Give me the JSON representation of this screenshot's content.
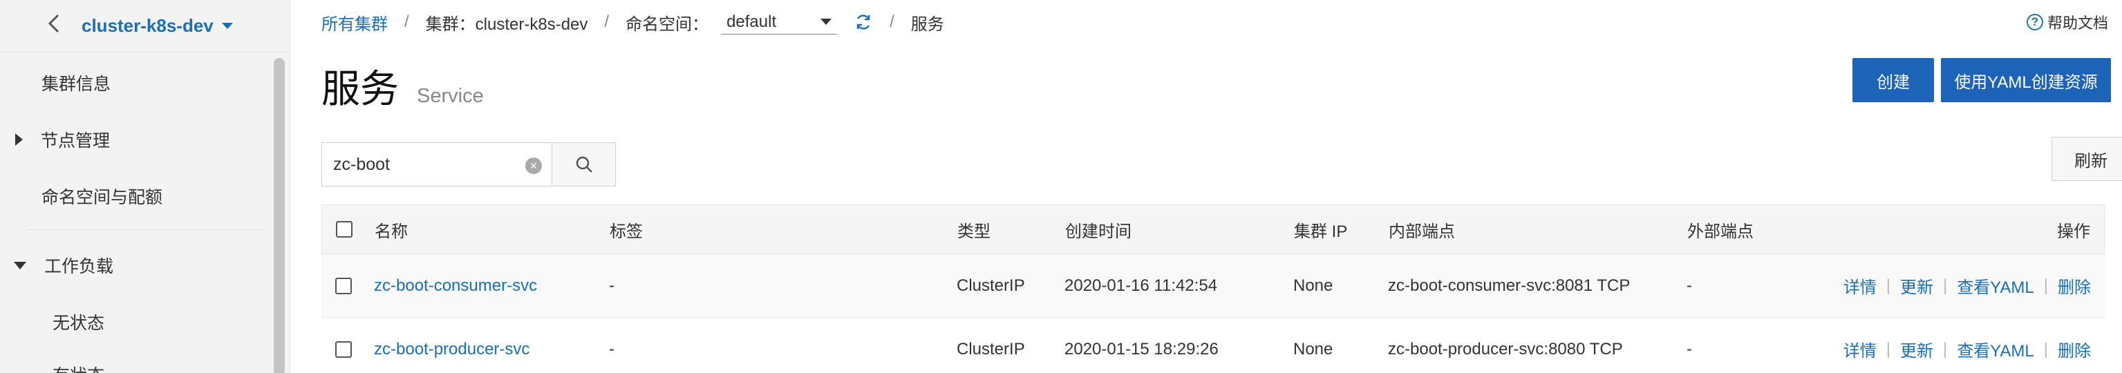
{
  "sidebar": {
    "cluster_name": "cluster-k8s-dev",
    "items": [
      {
        "label": "集群信息"
      },
      {
        "label": "节点管理"
      },
      {
        "label": "命名空间与配额"
      },
      {
        "label": "工作负载"
      },
      {
        "label": "无状态"
      },
      {
        "label": "有状态"
      }
    ]
  },
  "breadcrumb": {
    "all_clusters": "所有集群",
    "cluster_label": "集群：cluster-k8s-dev",
    "namespace_label": "命名空间：",
    "namespace_value": "default",
    "current": "服务"
  },
  "help": {
    "label": "帮助文档"
  },
  "page": {
    "title": "服务",
    "subtitle": "Service"
  },
  "toolbar": {
    "create": "创建",
    "create_yaml": "使用YAML创建资源",
    "refresh": "刷新"
  },
  "search": {
    "value": "zc-boot"
  },
  "table": {
    "columns": [
      "名称",
      "标签",
      "类型",
      "创建时间",
      "集群 IP",
      "内部端点",
      "外部端点",
      "操作"
    ],
    "rows": [
      {
        "name": "zc-boot-consumer-svc",
        "labels": "-",
        "type": "ClusterIP",
        "created": "2020-01-16 11:42:54",
        "cluster_ip": "None",
        "internal": "zc-boot-consumer-svc:8081 TCP",
        "external": "-"
      },
      {
        "name": "zc-boot-producer-svc",
        "labels": "-",
        "type": "ClusterIP",
        "created": "2020-01-15 18:29:26",
        "cluster_ip": "None",
        "internal": "zc-boot-producer-svc:8080 TCP",
        "external": "-"
      }
    ],
    "actions": [
      "详情",
      "更新",
      "查看YAML",
      "删除"
    ]
  },
  "colors": {
    "accent": "#1a6fb8",
    "primary_button": "#1d63b8",
    "sidebar_bg": "#f3f3f3"
  }
}
